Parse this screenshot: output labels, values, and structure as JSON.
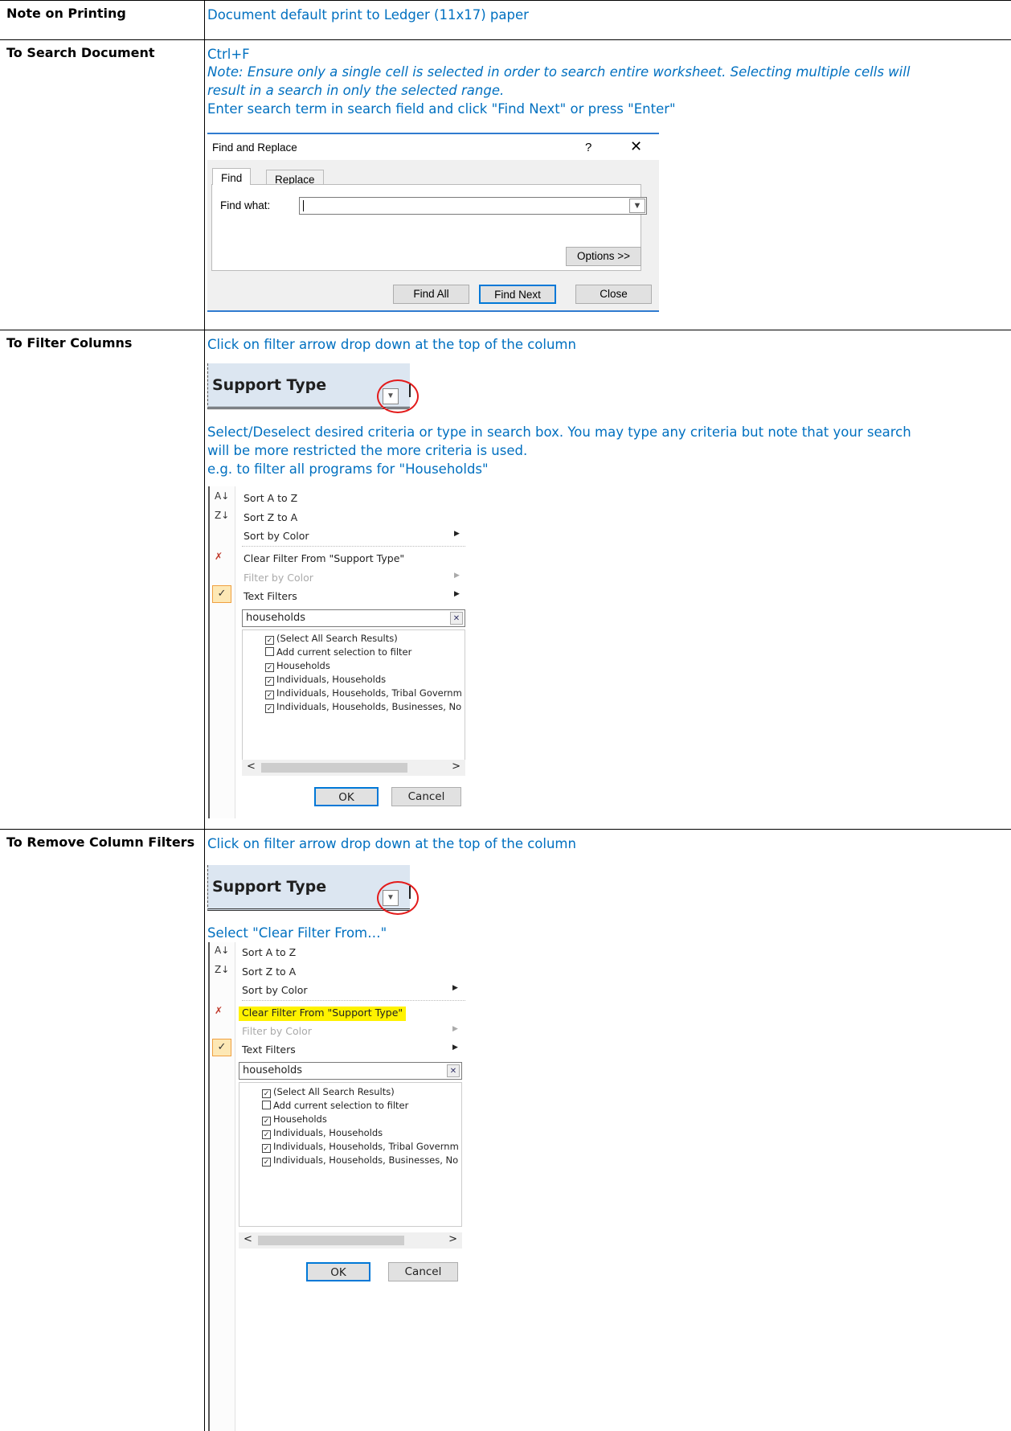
{
  "rows": {
    "printing": {
      "label": "Note on Printing",
      "text": "Document default print to Ledger (11x17) paper"
    },
    "search": {
      "label": "To Search Document",
      "shortcut": "Ctrl+F",
      "note_line1": "Note: Ensure only a single cell is selected in order to search entire worksheet. Selecting multiple cells will",
      "note_line2": "result in a search in only the selected range.",
      "instruction": "Enter search term in search field and click \"Find Next\" or press \"Enter\""
    },
    "filter": {
      "label": "To Filter Columns",
      "instruction": "Click on filter arrow drop down at the top of the column",
      "desc_line1": "Select/Deselect desired criteria or type in search box. You may type any criteria but note that your search",
      "desc_line2": "will be more restricted the more criteria is used.",
      "example": "e.g. to filter all programs for \"Households\""
    },
    "remove": {
      "label": "To Remove Column Filters",
      "instruction": "Click on filter arrow drop down at the top of the column",
      "select": "Select \"Clear Filter From…\""
    }
  },
  "find_dialog": {
    "title": "Find and Replace",
    "help": "?",
    "close_glyph": "✕",
    "tab_find": "Find",
    "tab_replace": "Replace",
    "find_label": "Find what:",
    "find_value": "",
    "options_button": "Options >>",
    "find_all_button": "Find All",
    "find_next_button": "Find Next",
    "close_button": "Close"
  },
  "column_header": {
    "title": "Support Type"
  },
  "filter_menu": {
    "sort_az": "Sort A to Z",
    "sort_za": "Sort Z to A",
    "sort_color": "Sort by Color",
    "clear_filter": "Clear Filter From \"Support Type\"",
    "filter_color": "Filter by Color",
    "text_filters": "Text Filters",
    "search_value": "households",
    "items": [
      {
        "label": "(Select All Search Results)",
        "checked": true
      },
      {
        "label": "Add current selection to filter",
        "checked": false
      },
      {
        "label": "Households",
        "checked": true
      },
      {
        "label": "Individuals, Households",
        "checked": true
      },
      {
        "label": "Individuals, Households, Tribal Governm",
        "checked": true
      },
      {
        "label": "Individuals, Households, Businesses, No",
        "checked": true
      }
    ],
    "ok_button": "OK",
    "cancel_button": "Cancel"
  },
  "colors": {
    "instruction_text": "#0070c0",
    "header_fill": "#dce6f1",
    "highlight": "#fff200",
    "annotation_circle": "#e31b1b"
  }
}
